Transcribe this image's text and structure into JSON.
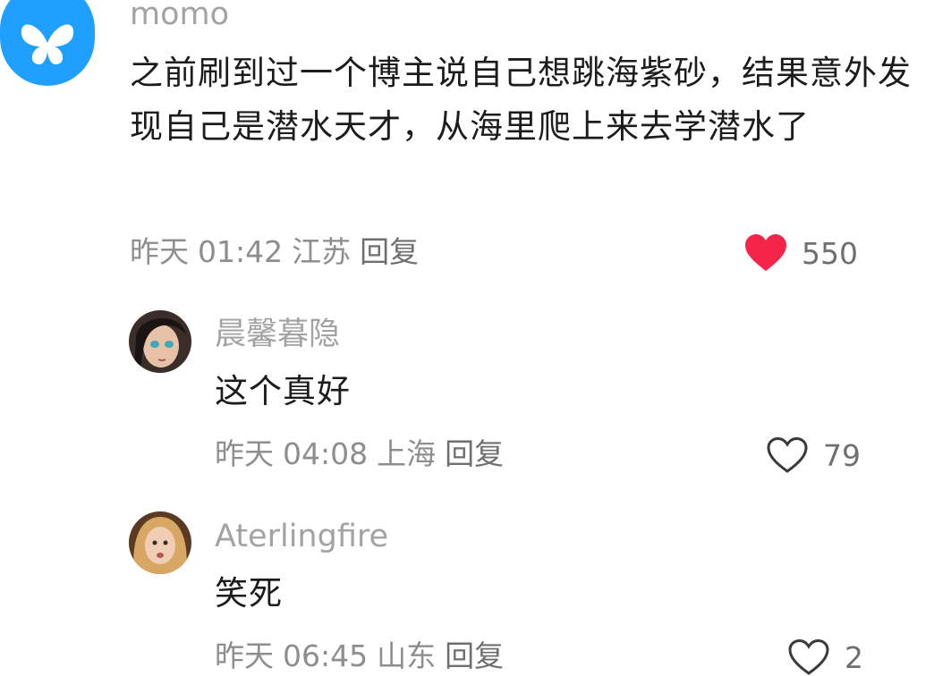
{
  "main_comment": {
    "username": "momo",
    "text": "之前刷到过一个博主说自己想跳海紫砂，结果意外发现自己是潜水天才，从海里爬上来去学潜水了",
    "date": "昨天",
    "time": "01:42",
    "location": "江苏",
    "reply_label": "回复",
    "likes": "550",
    "liked": true,
    "avatar_icon": "butterfly-icon",
    "accent_color": "#1fa0ff",
    "like_color": "#f5254a"
  },
  "replies": [
    {
      "username": "晨馨暮隐",
      "text": "这个真好",
      "date": "昨天",
      "time": "04:08",
      "location": "上海",
      "reply_label": "回复",
      "likes": "79",
      "liked": false
    },
    {
      "username": "Aterlingfire",
      "text": "笑死",
      "date": "昨天",
      "time": "06:45",
      "location": "山东",
      "reply_label": "回复",
      "likes": "2",
      "liked": false
    }
  ]
}
